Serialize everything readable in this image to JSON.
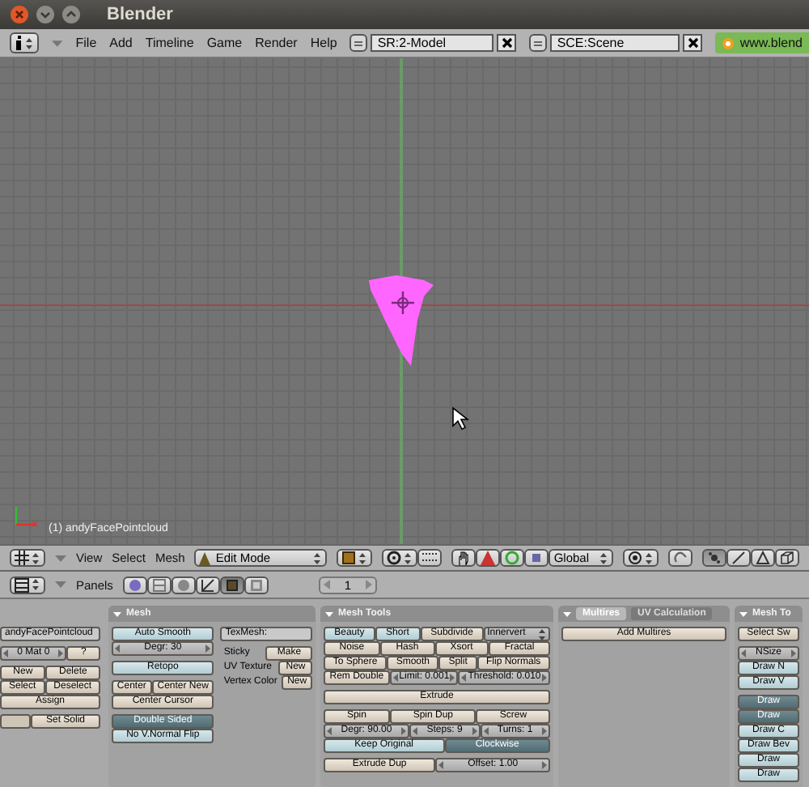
{
  "window": {
    "title": "Blender"
  },
  "info_header": {
    "menus": [
      "File",
      "Add",
      "Timeline",
      "Game",
      "Render",
      "Help"
    ],
    "screen": "SR:2-Model",
    "scene": "SCE:Scene",
    "status": "www.blend"
  },
  "viewport": {
    "object_label": "(1) andyFacePointcloud"
  },
  "view3d_header": {
    "menus": [
      "View",
      "Select",
      "Mesh"
    ],
    "mode": "Edit Mode",
    "orientation": "Global",
    "select_modes": [
      {
        "selected": true
      },
      {
        "selected": false
      },
      {
        "selected": false
      }
    ]
  },
  "buttons_header": {
    "label": "Panels",
    "context_tabs": [
      {
        "selected": false
      },
      {
        "selected": false
      },
      {
        "selected": false
      },
      {
        "selected": false
      },
      {
        "selected": true
      },
      {
        "selected": false
      }
    ],
    "frame": "1"
  },
  "panels": [
    {
      "columns": [
        {
          "groups": [
            [
              [
                {
                  "kind": "text",
                  "label": "andyFacePointcloud"
                }
              ]
            ],
            [
              [
                {
                  "kind": "num",
                  "label": "0 Mat 0"
                },
                {
                  "kind": "button",
                  "label": "?"
                }
              ]
            ],
            [
              [
                {
                  "kind": "button",
                  "label": "New"
                },
                {
                  "kind": "button",
                  "label": "Delete"
                }
              ],
              [
                {
                  "kind": "button",
                  "label": "Select"
                },
                {
                  "kind": "button",
                  "label": "Deselect"
                }
              ],
              [
                {
                  "kind": "button",
                  "label": "Assign"
                }
              ]
            ],
            [
              [
                {
                  "kind": "swatch"
                },
                {
                  "kind": "button",
                  "label": "Set Solid"
                }
              ]
            ]
          ]
        }
      ]
    },
    {
      "title": "Mesh",
      "columns": [
        {
          "groups": [
            [
              [
                {
                  "kind": "toggle",
                  "label": "Auto Smooth",
                  "on": false
                }
              ],
              [
                {
                  "kind": "num",
                  "label": "Degr: 30"
                }
              ]
            ],
            [
              [
                {
                  "kind": "toggle",
                  "label": "Retopo",
                  "on": false
                }
              ]
            ],
            [
              [
                {
                  "kind": "button",
                  "label": "Center"
                },
                {
                  "kind": "button",
                  "label": "Center New"
                }
              ],
              [
                {
                  "kind": "button",
                  "label": "Center Cursor"
                }
              ]
            ],
            [
              [
                {
                  "kind": "toggle",
                  "label": "Double Sided",
                  "on": true
                }
              ],
              [
                {
                  "kind": "toggle",
                  "label": "No V.Normal Flip",
                  "on": false
                }
              ]
            ]
          ]
        },
        {
          "groups": [
            [
              [
                {
                  "kind": "text",
                  "label": "TexMesh:"
                }
              ]
            ],
            [
              [
                {
                  "kind": "label",
                  "label": "Sticky"
                },
                {
                  "kind": "button",
                  "label": "Make"
                }
              ],
              [
                {
                  "kind": "label",
                  "label": "UV Texture"
                },
                {
                  "kind": "button",
                  "label": "New"
                }
              ],
              [
                {
                  "kind": "label",
                  "label": "Vertex Color"
                },
                {
                  "kind": "button",
                  "label": "New"
                }
              ]
            ]
          ]
        }
      ]
    },
    {
      "title": "Mesh Tools",
      "columns": [
        {
          "groups": [
            [
              [
                {
                  "kind": "toggle",
                  "label": "Beauty",
                  "on": false
                },
                {
                  "kind": "toggle",
                  "label": "Short",
                  "on": false
                },
                {
                  "kind": "button",
                  "label": "Subdivide"
                },
                {
                  "kind": "menu",
                  "label": "Innervert"
                }
              ],
              [
                {
                  "kind": "button",
                  "label": "Noise"
                },
                {
                  "kind": "button",
                  "label": "Hash"
                },
                {
                  "kind": "button",
                  "label": "Xsort"
                },
                {
                  "kind": "button",
                  "label": "Fractal"
                }
              ],
              [
                {
                  "kind": "button",
                  "label": "To Sphere"
                },
                {
                  "kind": "button",
                  "label": "Smooth"
                },
                {
                  "kind": "button",
                  "label": "Split"
                },
                {
                  "kind": "button",
                  "label": "Flip Normals"
                }
              ],
              [
                {
                  "kind": "button",
                  "label": "Rem Double"
                },
                {
                  "kind": "num",
                  "label": "Limit: 0.001"
                },
                {
                  "kind": "num",
                  "label": "Threshold: 0.010"
                }
              ]
            ],
            [
              [
                {
                  "kind": "button",
                  "label": "Extrude"
                }
              ]
            ],
            [
              [
                {
                  "kind": "button",
                  "label": "Spin"
                },
                {
                  "kind": "button",
                  "label": "Spin Dup"
                },
                {
                  "kind": "button",
                  "label": "Screw"
                }
              ],
              [
                {
                  "kind": "num",
                  "label": "Degr: 90.00"
                },
                {
                  "kind": "num",
                  "label": "Steps: 9"
                },
                {
                  "kind": "num",
                  "label": "Turns: 1"
                }
              ],
              [
                {
                  "kind": "toggle",
                  "label": "Keep Original",
                  "on": false
                },
                {
                  "kind": "toggle",
                  "label": "Clockwise",
                  "on": true
                }
              ]
            ],
            [
              [
                {
                  "kind": "button",
                  "label": "Extrude Dup"
                },
                {
                  "kind": "num",
                  "label": "Offset: 1.00"
                }
              ]
            ]
          ]
        }
      ]
    },
    {
      "tabs": [
        {
          "label": "Multires",
          "selected": true
        },
        {
          "label": "UV Calculation",
          "selected": false
        }
      ],
      "columns": [
        {
          "groups": [
            [
              [
                {
                  "kind": "button",
                  "label": "Add Multires"
                }
              ]
            ]
          ]
        }
      ]
    },
    {
      "title": "Mesh To",
      "columns": [
        {
          "groups": [
            [
              [
                {
                  "kind": "button",
                  "label": "Select Sw"
                }
              ]
            ],
            [
              [
                {
                  "kind": "num",
                  "label": "NSize"
                }
              ],
              [
                {
                  "kind": "toggle",
                  "label": "Draw N",
                  "on": false
                }
              ],
              [
                {
                  "kind": "toggle",
                  "label": "Draw V",
                  "on": false
                }
              ]
            ],
            [
              [
                {
                  "kind": "toggle",
                  "label": "Draw",
                  "on": true
                }
              ],
              [
                {
                  "kind": "toggle",
                  "label": "Draw",
                  "on": true
                }
              ],
              [
                {
                  "kind": "toggle",
                  "label": "Draw C",
                  "on": false
                }
              ],
              [
                {
                  "kind": "toggle",
                  "label": "Draw Bev",
                  "on": false
                }
              ],
              [
                {
                  "kind": "toggle",
                  "label": "Draw",
                  "on": false
                }
              ],
              [
                {
                  "kind": "toggle",
                  "label": "Draw",
                  "on": false
                }
              ]
            ]
          ]
        }
      ]
    }
  ]
}
